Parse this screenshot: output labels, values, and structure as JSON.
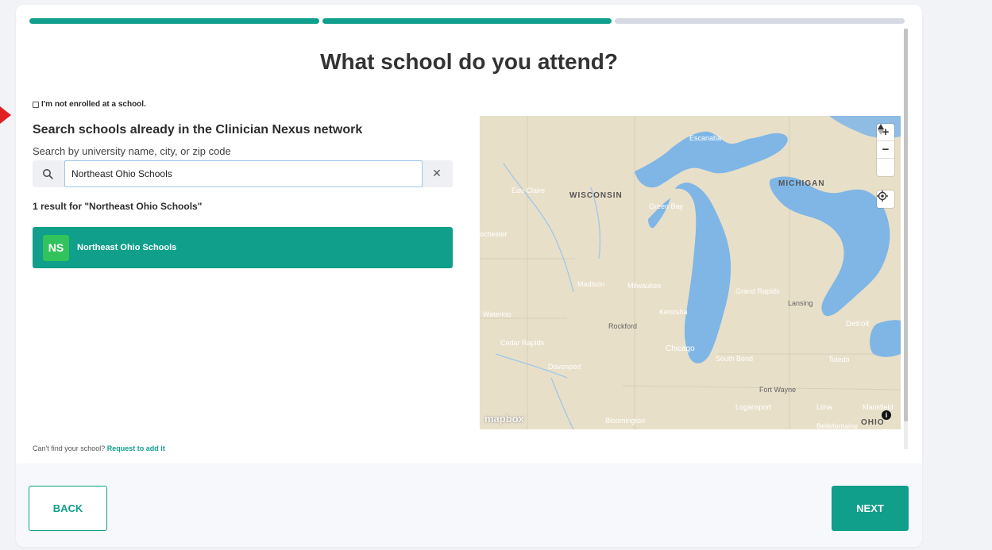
{
  "progress": {
    "steps_total": 3,
    "steps_done": 2
  },
  "title": "What school do you attend?",
  "not_enrolled_label": "I'm not enrolled at a school.",
  "search": {
    "heading": "Search schools already in the Clinician Nexus network",
    "hint": "Search by university name, city, or zip code",
    "value": "Northeast Ohio Schools",
    "placeholder": ""
  },
  "results": {
    "count_text": "1 result for \"Northeast Ohio Schools\"",
    "items": [
      {
        "initials": "NS",
        "name": "Northeast Ohio Schools"
      }
    ]
  },
  "footer_note": {
    "text": "Can't find your school?",
    "link": "Request to add it"
  },
  "map": {
    "labels": {
      "escanaba": "Escanaba",
      "eau_claire": "Eau Claire",
      "wisconsin": "WISCONSIN",
      "green_bay": "Green Bay",
      "michigan": "MICHIGAN",
      "rochester": "ochester",
      "madison": "Madison",
      "milwaukee": "Milwaukee",
      "grand_rapids": "Grand Rapids",
      "lansing": "Lansing",
      "kenosha": "Kenosha",
      "waterloo": "Waterloo",
      "rockford": "Rockford",
      "detroit": "Detroit",
      "cedar_rapids": "Cedar Rapids",
      "chicago": "Chicago",
      "davenport": "Davenport",
      "south_bend": "South Bend",
      "toledo": "Toledo",
      "fort_wayne": "Fort Wayne",
      "logansport": "Logansport",
      "lima": "Lima",
      "mansfield": "Mansfield",
      "bloomington": "Bloomington",
      "bellefontaine": "Bellefontaine",
      "ohio": "OHIO"
    },
    "attribution": "mapbox",
    "colors": {
      "land": "#e8dfc9",
      "water": "#7fb6e6"
    }
  },
  "buttons": {
    "back": "BACK",
    "next": "NEXT"
  },
  "colors": {
    "accent": "#0f9f8b",
    "avatar": "#32c35c"
  }
}
